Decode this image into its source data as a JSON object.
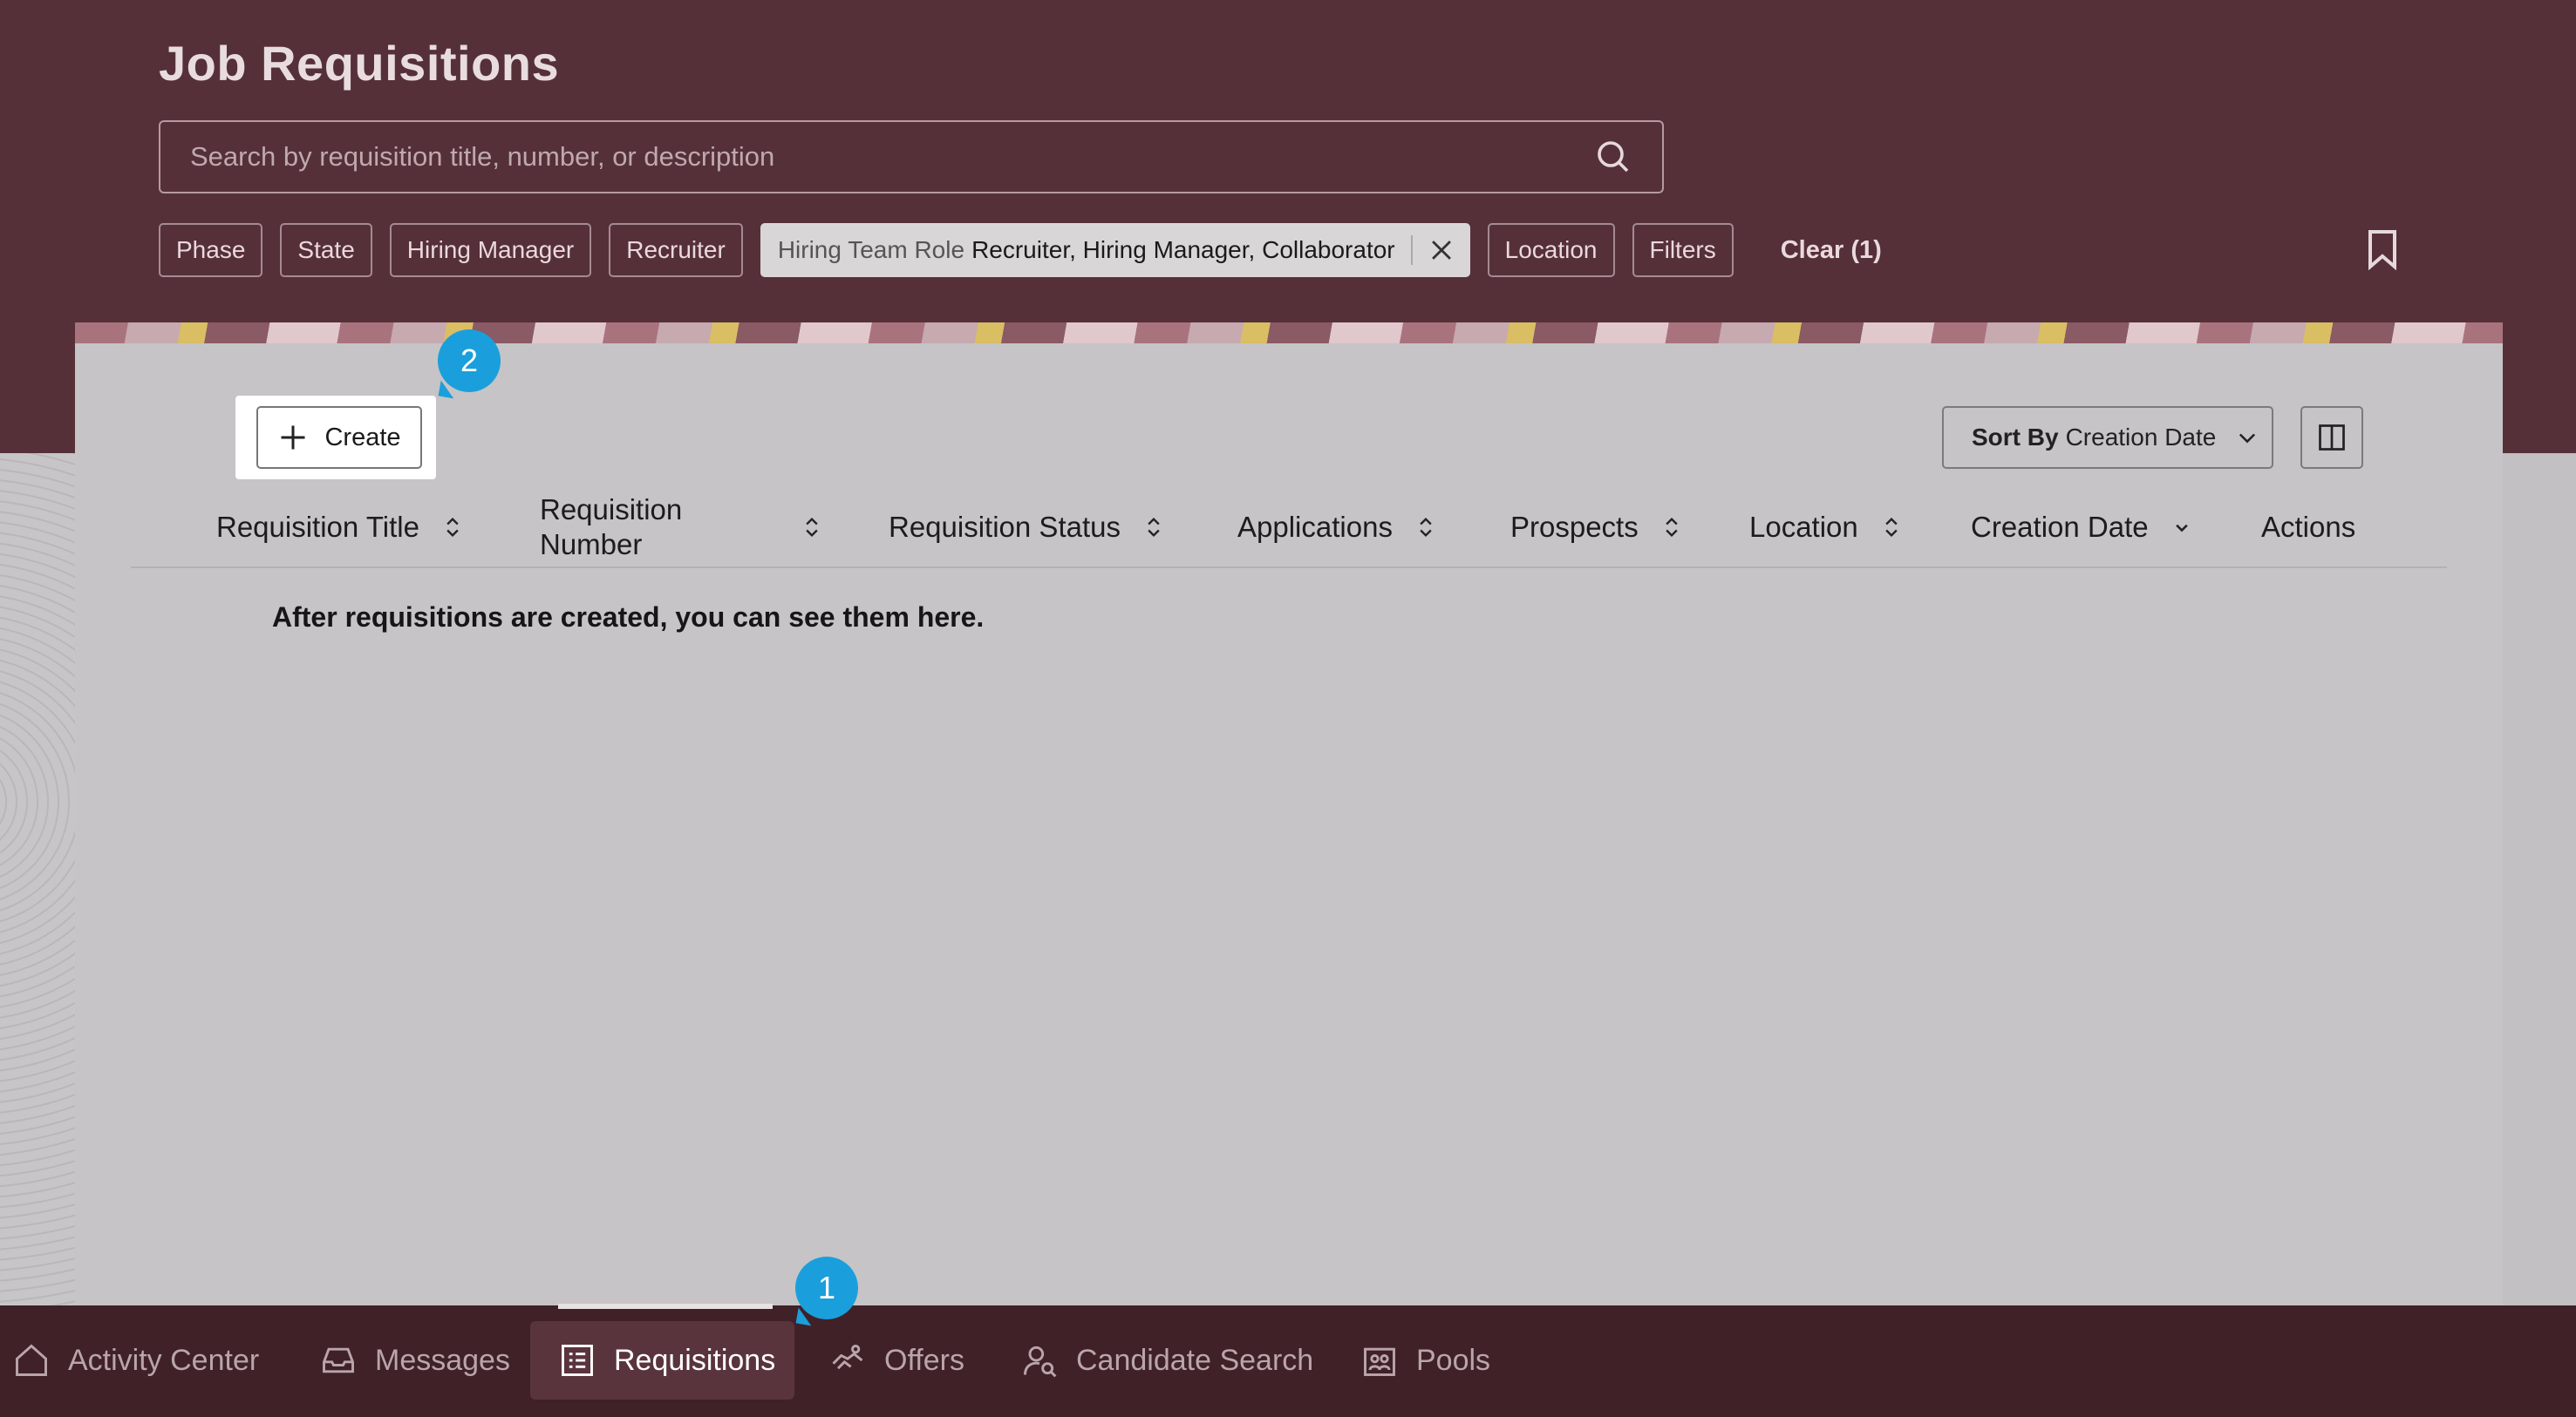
{
  "header": {
    "title": "Job Requisitions",
    "search_placeholder": "Search by requisition title, number, or description"
  },
  "filters": {
    "chips": [
      "Phase",
      "State",
      "Hiring Manager",
      "Recruiter"
    ],
    "active_chip": {
      "key": "Hiring Team Role",
      "value": "Recruiter, Hiring Manager, Collaborator"
    },
    "chips_after": [
      "Location",
      "Filters"
    ],
    "clear_label": "Clear (1)"
  },
  "toolbar": {
    "create_label": "Create",
    "sort_prefix": "Sort By",
    "sort_value": "Creation Date"
  },
  "table": {
    "columns": [
      "Requisition Title",
      "Requisition Number",
      "Requisition Status",
      "Applications",
      "Prospects",
      "Location",
      "Creation Date",
      "Actions"
    ],
    "empty_message": "After requisitions are created, you can see them here."
  },
  "badges": {
    "badge_1": "1",
    "badge_2": "2"
  },
  "bottom_nav": {
    "items": [
      "Activity Center",
      "Messages",
      "Requisitions",
      "Offers",
      "Candidate Search",
      "Pools"
    ],
    "active": "Requisitions"
  },
  "colors": {
    "header_bg": "#563039",
    "nav_bg": "#3f2127",
    "badge": "#1a9fdc"
  },
  "icons": [
    "search-icon",
    "close-icon",
    "bookmark-icon",
    "plus-icon",
    "chevron-down-icon",
    "columns-icon",
    "sort-icon",
    "home-icon",
    "inbox-icon",
    "list-icon",
    "handshake-icon",
    "person-search-icon",
    "building-icon"
  ]
}
